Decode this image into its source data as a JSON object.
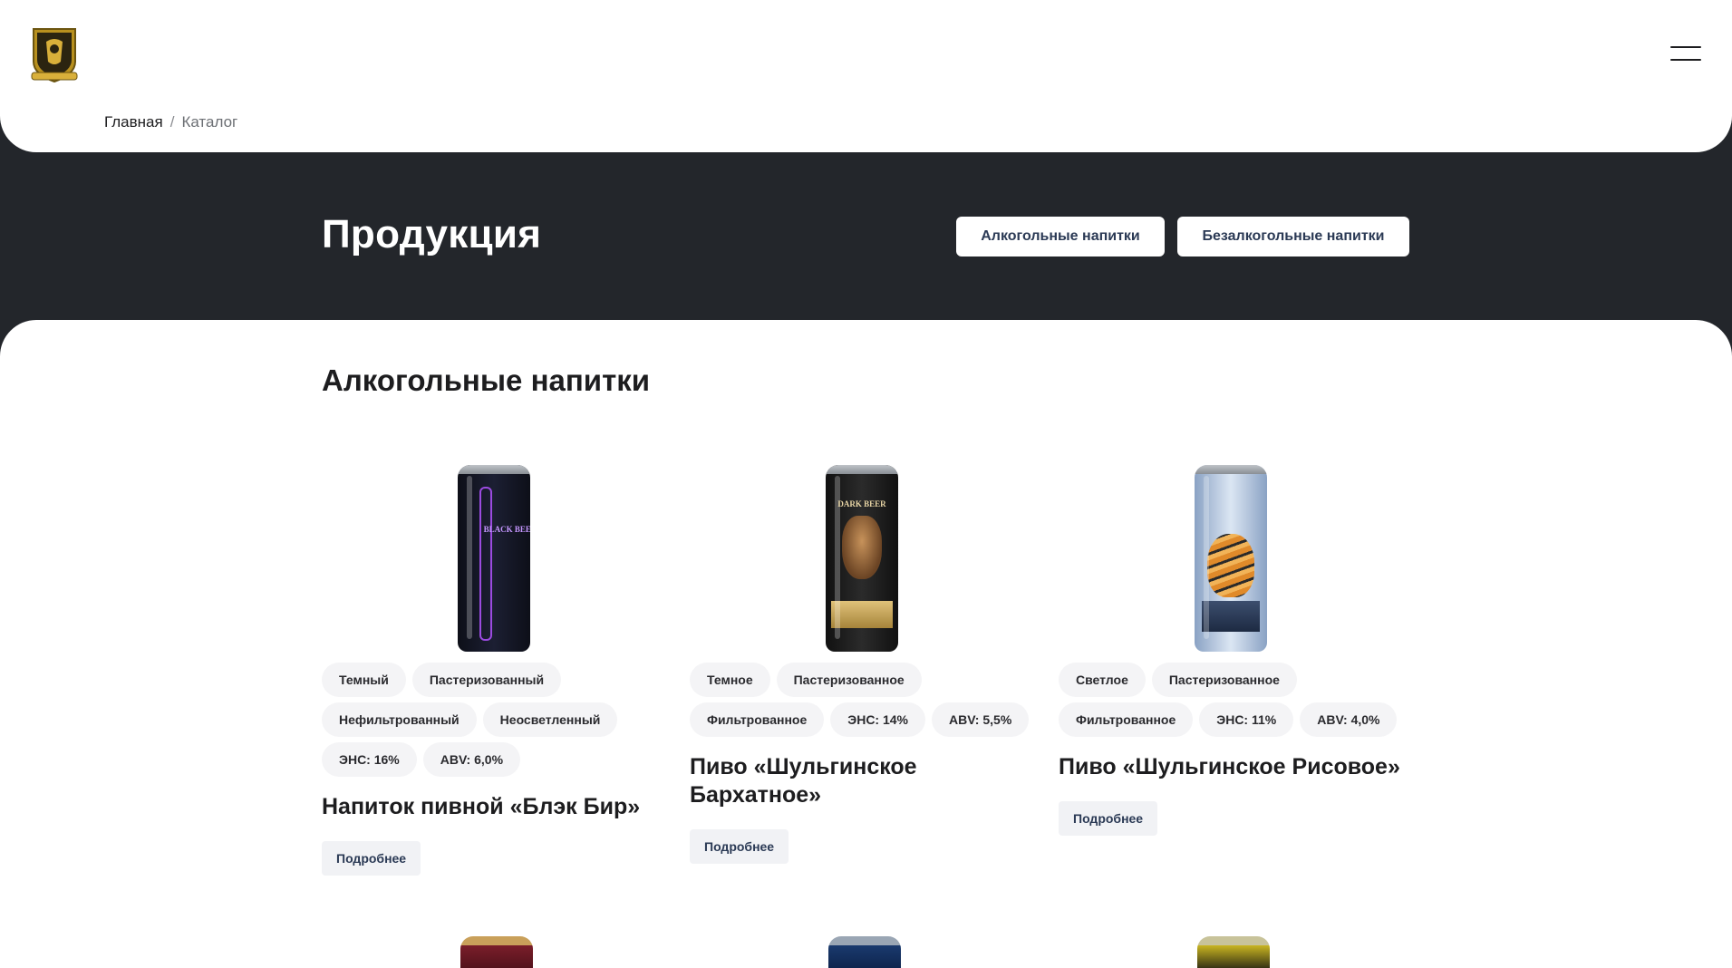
{
  "header": {
    "logo_alt": "logo",
    "menu_icon": "hamburger-menu-icon"
  },
  "breadcrumb": {
    "home": "Главная",
    "separator": "/",
    "current": "Каталог"
  },
  "hero": {
    "title": "Продукция",
    "buttons": [
      "Алкогольные напитки",
      "Безалкогольные напитки"
    ]
  },
  "section": {
    "title": "Алкогольные напитки"
  },
  "products": [
    {
      "title": "Напиток пивной «Блэк Бир»",
      "tags": [
        "Темный",
        "Пастеризованный",
        "Нефильтрованный",
        "Неосветленный",
        "ЭНС: 16%",
        "ABV: 6,0%"
      ],
      "can_text": "BLACK BEER",
      "more_label": "Подробнее"
    },
    {
      "title": "Пиво «Шульгинское Бархатное»",
      "tags": [
        "Темное",
        "Пастеризованное",
        "Фильтрованное",
        "ЭНС: 14%",
        "ABV: 5,5%"
      ],
      "can_text": "DARK BEER",
      "more_label": "Подробнее"
    },
    {
      "title": "Пиво «Шульгинское Рисовое»",
      "tags": [
        "Светлое",
        "Пастеризованное",
        "Фильтрованное",
        "ЭНС: 11%",
        "ABV: 4,0%"
      ],
      "can_text": "",
      "more_label": "Подробнее"
    }
  ],
  "colors": {
    "dark_bg": "#23262b",
    "button_text": "#2b3a55",
    "tag_bg": "#f4f4f6"
  }
}
